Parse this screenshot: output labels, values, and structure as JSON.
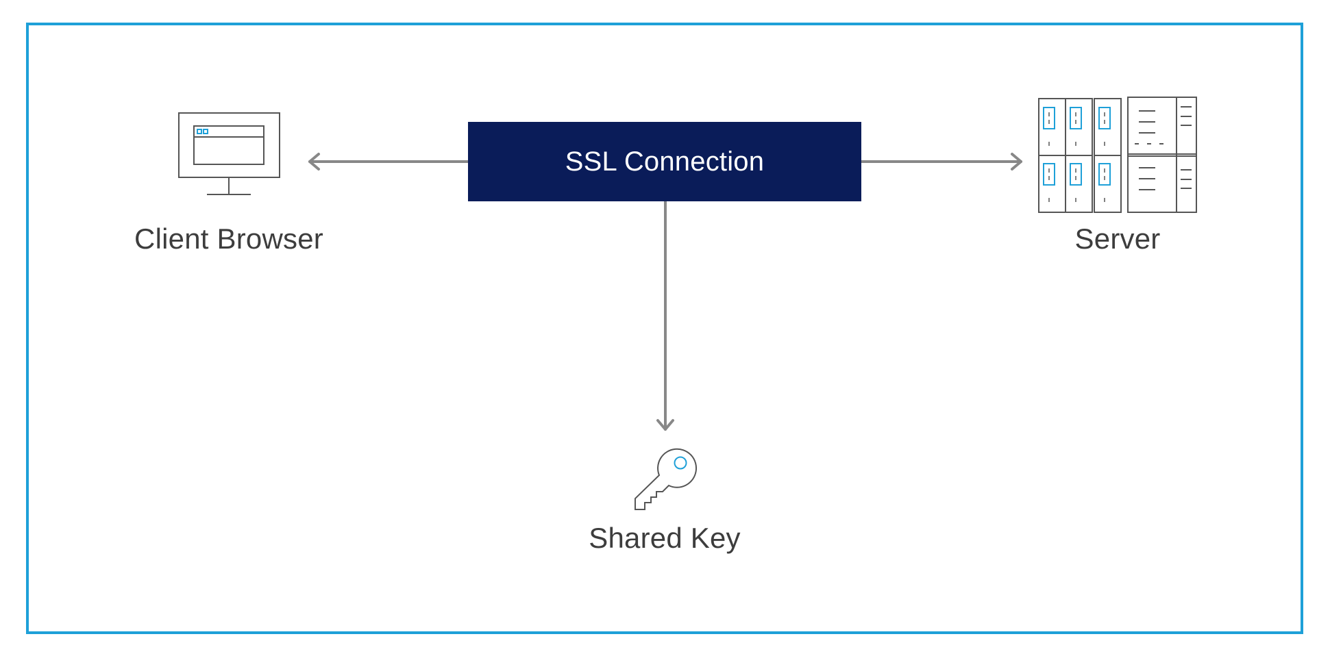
{
  "diagram": {
    "colors": {
      "frame": "#1ea0d8",
      "central_box": "#0a1c59",
      "central_text": "#ffffff",
      "arrow": "#888888",
      "icon_stroke": "#555555",
      "icon_accent": "#1ea0d8",
      "label_text": "#3d3d3d"
    },
    "central_node": {
      "label": "SSL Connection"
    },
    "nodes": [
      {
        "id": "client",
        "label": "Client Browser",
        "icon": "monitor-browser-icon"
      },
      {
        "id": "server",
        "label": "Server",
        "icon": "server-rack-icon"
      },
      {
        "id": "key",
        "label": "Shared Key",
        "icon": "key-icon"
      }
    ],
    "edges": [
      {
        "from": "SSL Connection",
        "to": "Client Browser",
        "direction": "left"
      },
      {
        "from": "SSL Connection",
        "to": "Server",
        "direction": "right"
      },
      {
        "from": "SSL Connection",
        "to": "Shared Key",
        "direction": "down"
      }
    ]
  }
}
